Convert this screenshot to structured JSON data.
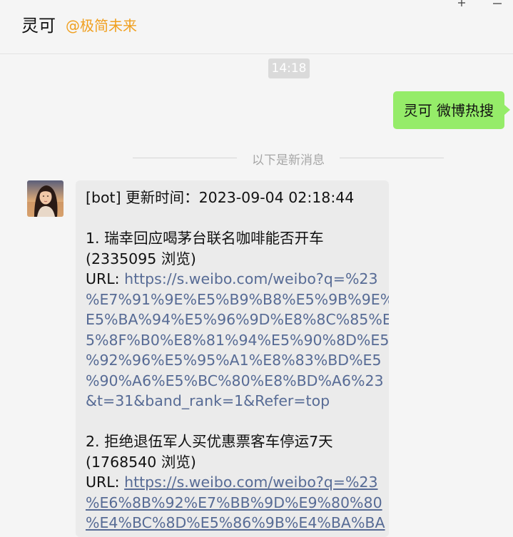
{
  "header": {
    "title": "灵可",
    "subtitle": "@极简未来",
    "controls": [
      "pin-icon",
      "minimize-icon"
    ]
  },
  "messages": {
    "timestamp": "14:18",
    "outgoing": "灵可 微博热搜",
    "divider": "以下是新消息",
    "incoming": {
      "header_line": "[bot] 更新时间：2023-09-04 02:18:44",
      "items": [
        {
          "title": "1. 瑞幸回应喝茅台联名咖啡能否开车",
          "views": "(2335095 浏览)",
          "url_prefix": "URL: ",
          "url_lines": [
            "https://s.weibo.com/weibo?q=%23",
            "%E7%91%9E%E5%B9%B8%E5%9B%9E%",
            "E5%BA%94%E5%96%9D%E8%8C%85%E",
            "5%8F%B0%E8%81%94%E5%90%8D%E5",
            "%92%96%E5%95%A1%E8%83%BD%E5",
            "%90%A6%E5%BC%80%E8%BD%A6%23",
            "&t=31&band_rank=1&Refer=top"
          ]
        },
        {
          "title": "2. 拒绝退伍军人买优惠票客车停运7天",
          "views": "(1768540 浏览)",
          "url_prefix": "URL: ",
          "url_lines": [
            "https://s.weibo.com/weibo?q=%23",
            "%E6%8B%92%E7%BB%9D%E9%80%80",
            "%E4%BC%8D%E5%86%9B%E4%BA%BA"
          ]
        }
      ]
    }
  },
  "colors": {
    "outgoing_bubble": "#95ec69",
    "incoming_bubble": "#ebebeb",
    "link": "#576b95",
    "subtitle": "#f0a020"
  }
}
